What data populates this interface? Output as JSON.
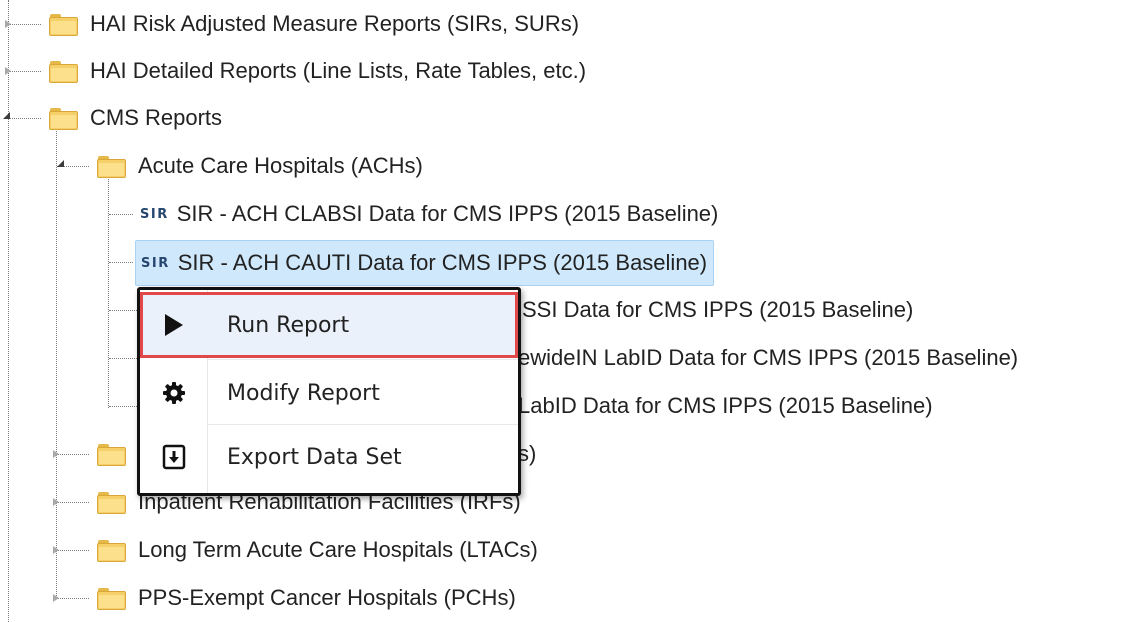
{
  "tree": {
    "root_items": [
      {
        "label": "HAI Risk Adjusted Measure Reports (SIRs, SURs)",
        "state": "collapsed",
        "icon": "folder-icon"
      },
      {
        "label": "HAI Detailed Reports (Line Lists, Rate Tables, etc.)",
        "state": "collapsed",
        "icon": "folder-icon"
      },
      {
        "label": "CMS Reports",
        "state": "expanded",
        "icon": "folder-icon"
      }
    ],
    "cms_children": [
      {
        "label": "Acute Care Hospitals (ACHs)",
        "state": "expanded",
        "icon": "folder-icon"
      },
      {
        "label": "",
        "state": "collapsed",
        "icon": "folder-icon"
      },
      {
        "label": "Inpatient Rehabilitation Facilities (IRFs)",
        "state": "collapsed",
        "icon": "folder-icon"
      },
      {
        "label": "Long Term Acute Care Hospitals (LTACs)",
        "state": "collapsed",
        "icon": "folder-icon"
      },
      {
        "label": "PPS-Exempt Cancer Hospitals (PCHs)",
        "state": "collapsed",
        "icon": "folder-icon"
      }
    ],
    "ach_reports": [
      {
        "badge": "SIR",
        "label": "SIR - ACH CLABSI Data for CMS IPPS (2015 Baseline)",
        "selected": false
      },
      {
        "badge": "SIR",
        "label": "SIR - ACH CAUTI Data for CMS IPPS (2015 Baseline)",
        "selected": true
      },
      {
        "badge": "",
        "label": "SSI Data for CMS IPPS (2015 Baseline)",
        "selected": false
      },
      {
        "badge": "",
        "label": "ewideIN LabID Data for CMS IPPS (2015 Baseline)",
        "selected": false
      },
      {
        "badge": "",
        "label": "LabID Data for CMS IPPS (2015 Baseline)",
        "selected": false
      }
    ],
    "partial_hidden_label_tail": "s)"
  },
  "context_menu": {
    "items": [
      {
        "label": "Run Report",
        "icon": "play-icon",
        "highlighted": true
      },
      {
        "label": "Modify Report",
        "icon": "gear-icon",
        "highlighted": false
      },
      {
        "label": "Export Data Set",
        "icon": "export-icon",
        "highlighted": false
      }
    ]
  },
  "colors": {
    "selection_bg": "#cfe8fb",
    "highlight_border": "#e0484a",
    "folder": "#f5cf67",
    "sir_badge": "#24466f"
  }
}
